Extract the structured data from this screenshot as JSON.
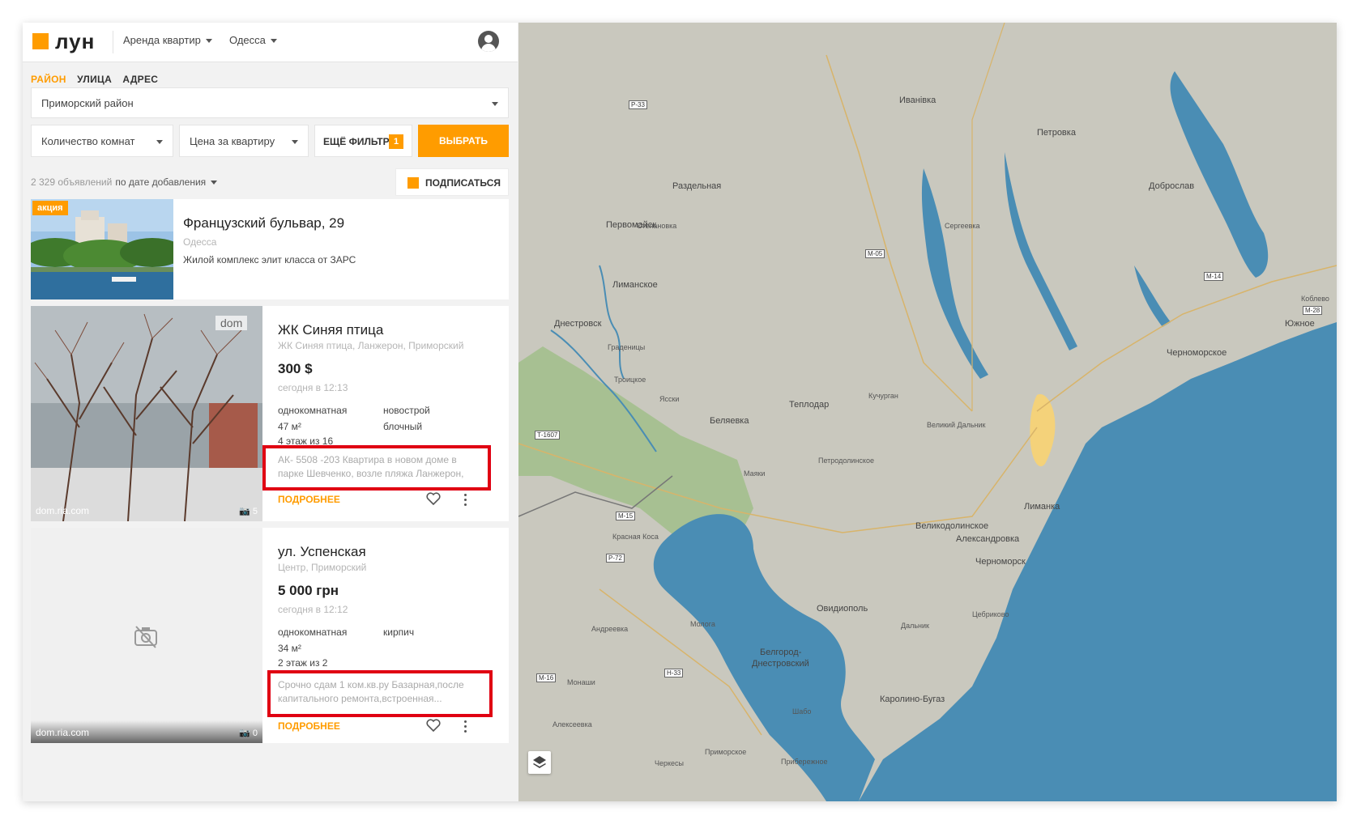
{
  "header": {
    "logo": "лун",
    "nav_rent": "Аренда квартир",
    "nav_city": "Одесса"
  },
  "search_tabs": [
    {
      "label": "РАЙОН",
      "active": true
    },
    {
      "label": "УЛИЦА",
      "active": false
    },
    {
      "label": "АДРЕС",
      "active": false
    }
  ],
  "filters": {
    "district": "Приморский район",
    "rooms": "Количество комнат",
    "price": "Цена за квартиру",
    "more_label": "ЕЩЁ ФИЛЬТРЫ",
    "more_count": "1",
    "select_label": "ВЫБРАТЬ"
  },
  "results": {
    "count": "2 329 объявлений",
    "sort": "по дате добавления",
    "subscribe": "ПОДПИСАТЬСЯ"
  },
  "promo": {
    "badge": "акция",
    "title": "Французский бульвар, 29",
    "city": "Одесса",
    "description": "Жилой комплекс элит класса от ЗАРС"
  },
  "listings": [
    {
      "title": "ЖК Синяя птица",
      "address": "ЖК Синяя птица, Ланжерон, Приморский",
      "price": "300 $",
      "time": "сегодня в 12:13",
      "rooms": "однокомнатная",
      "type": "новострой",
      "area": "47 м²",
      "material": "блочный",
      "floor": "4 этаж из 16",
      "snippet_line1": "АК- 5508 -203 Квартира в новом доме в",
      "snippet_line2": "парке Шевченко, возле пляжа Ланжерон,",
      "more": "ПОДРОБНЕЕ",
      "photo_watermark": "dom.ria.com",
      "photo_badge": "dom",
      "photo_count": "5"
    },
    {
      "title": "ул. Успенская",
      "address": "Центр, Приморский",
      "price": "5 000 грн",
      "time": "сегодня в 12:12",
      "rooms": "однокомнатная",
      "type": "кирпич",
      "area": "34 м²",
      "material": "",
      "floor": "2 этаж из 2",
      "snippet_line1": "Срочно сдам 1 ком.кв.ру Базарная,после",
      "snippet_line2": "капитального ремонта,встроенная...",
      "more": "ПОДРОБНЕЕ",
      "photo_watermark": "dom.ria.com",
      "photo_count": "0"
    }
  ],
  "map": {
    "sea_color": "#4a8db4",
    "land_color": "#c9c8be",
    "city_highlight": "#f4d27a",
    "labels": [
      {
        "text": "Первомайск",
        "cls": ""
      },
      {
        "text": "Днестровск",
        "cls": ""
      },
      {
        "text": "Беляевка",
        "cls": ""
      },
      {
        "text": "Теплодар",
        "cls": ""
      },
      {
        "text": "Иванівка",
        "cls": ""
      },
      {
        "text": "Петровка",
        "cls": ""
      },
      {
        "text": "Доброслав",
        "cls": ""
      },
      {
        "text": "Лиманка",
        "cls": ""
      },
      {
        "text": "Великодолинское",
        "cls": ""
      },
      {
        "text": "Александровка",
        "cls": ""
      },
      {
        "text": "Черноморск",
        "cls": ""
      },
      {
        "text": "Овидиополь",
        "cls": ""
      },
      {
        "text": "Белгород-",
        "cls": ""
      },
      {
        "text": "Днестровский",
        "cls": ""
      },
      {
        "text": "Каролино-Бугаз",
        "cls": ""
      },
      {
        "text": "Южное",
        "cls": ""
      },
      {
        "text": "Черноморское",
        "cls": ""
      },
      {
        "text": "Раздельная",
        "cls": ""
      },
      {
        "text": "Лиманское",
        "cls": ""
      },
      {
        "text": "Сергеевка",
        "cls": "sm"
      },
      {
        "text": "Дальник",
        "cls": "sm"
      },
      {
        "text": "Маяки",
        "cls": "sm"
      },
      {
        "text": "Граденицы",
        "cls": "sm"
      },
      {
        "text": "Троицкое",
        "cls": "sm"
      },
      {
        "text": "Ясски",
        "cls": "sm"
      },
      {
        "text": "Кучурган",
        "cls": "sm"
      },
      {
        "text": "Степановка",
        "cls": "sm"
      },
      {
        "text": "Коблево",
        "cls": "sm"
      },
      {
        "text": "Великий Дальник",
        "cls": "sm"
      },
      {
        "text": "Петродолинское",
        "cls": "sm"
      },
      {
        "text": "Красная Коса",
        "cls": "sm"
      },
      {
        "text": "Шабо",
        "cls": "sm"
      },
      {
        "text": "Приморское",
        "cls": "sm"
      },
      {
        "text": "Черкесы",
        "cls": "sm"
      },
      {
        "text": "Молога",
        "cls": "sm"
      },
      {
        "text": "Андреевка",
        "cls": "sm"
      },
      {
        "text": "Монаши",
        "cls": "sm"
      },
      {
        "text": "Алексеевка",
        "cls": "sm"
      },
      {
        "text": "Цебриково",
        "cls": "sm"
      },
      {
        "text": "Прибережное",
        "cls": "sm"
      }
    ],
    "roads": [
      "М-05",
      "Р-33",
      "М-14",
      "М-15",
      "Р-72",
      "М-16",
      "М-28",
      "Н-33",
      "Т-1607"
    ],
    "layers_icon": "layers-icon"
  }
}
